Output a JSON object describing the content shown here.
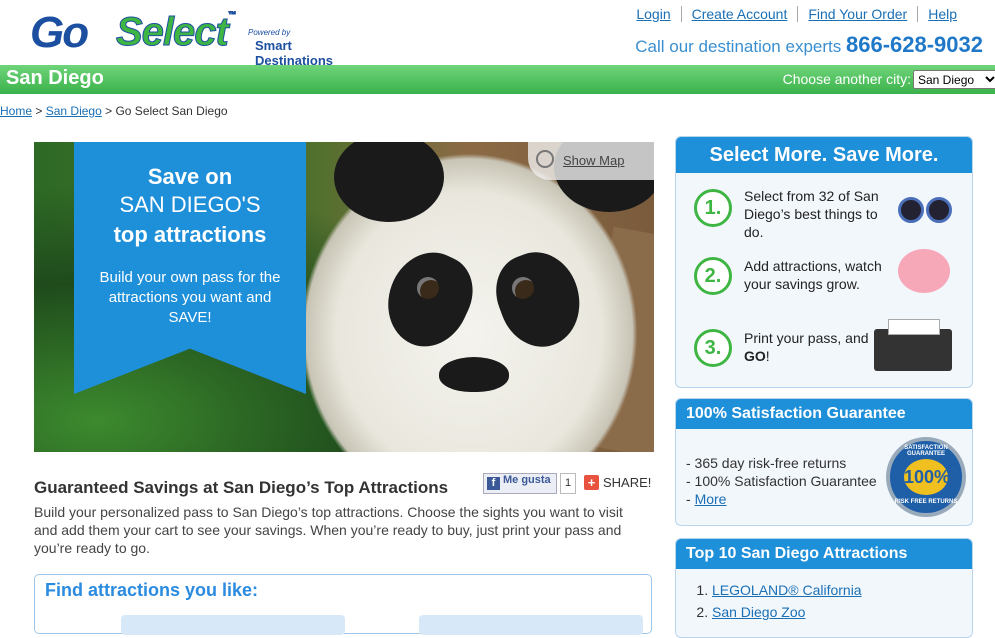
{
  "header": {
    "logo_go": "Go",
    "logo_select": "Select",
    "tm": "™",
    "powered_by": "Powered by",
    "smart_destinations": "Smart Destinations",
    "links": [
      "Login",
      "Create Account",
      "Find Your Order",
      "Help"
    ],
    "call_text": "Call our destination experts",
    "phone": "866-628-9032"
  },
  "citybar": {
    "city": "San Diego",
    "choose_label": "Choose another city:",
    "selected_city": "San Diego"
  },
  "breadcrumb": {
    "home": "Home",
    "sep": ">",
    "city": "San Diego",
    "current": "Go Select San Diego"
  },
  "hero": {
    "line1": "Save on",
    "line2": "SAN DIEGO'S",
    "line3": "top attractions",
    "subtext": "Build your own pass for the attractions you want and SAVE!",
    "show_map": "Show Map"
  },
  "social": {
    "like": "Me gusta",
    "like_count": "1",
    "share": "SHARE!"
  },
  "main": {
    "title": "Guaranteed Savings at San Diego’s Top Attractions",
    "body": "Build your personalized pass to San Diego’s top attractions. Choose the sights you want to visit and add them your cart to see your savings. When you’re ready to buy, just print your pass and you’re ready to go.",
    "find_title": "Find attractions you like:"
  },
  "sidebar": {
    "select_more": {
      "title": "Select More. Save More.",
      "steps": [
        {
          "num": "1.",
          "text": "Select from 32 of San Diego’s best things to do."
        },
        {
          "num": "2.",
          "text": "Add attractions, watch your savings grow."
        },
        {
          "num": "3.",
          "text_pre": "Print your pass, and ",
          "text_bold": "GO",
          "text_post": "!"
        }
      ]
    },
    "guarantee": {
      "title": "100% Satisfaction Guarantee",
      "items": [
        "- 365 day risk-free returns",
        "- 100% Satisfaction Guarantee"
      ],
      "more_prefix": "- ",
      "more": "More",
      "seal_top": "SATISFACTION GUARANTEE",
      "seal_center": "100%",
      "seal_bottom": "RISK FREE RETURNS"
    },
    "top10": {
      "title": "Top 10 San Diego Attractions",
      "items": [
        "LEGOLAND® California",
        "San Diego Zoo"
      ]
    }
  },
  "colors": {
    "accent_blue": "#1e8fd9",
    "green": "#3fb543",
    "link": "#1a6fb5"
  }
}
